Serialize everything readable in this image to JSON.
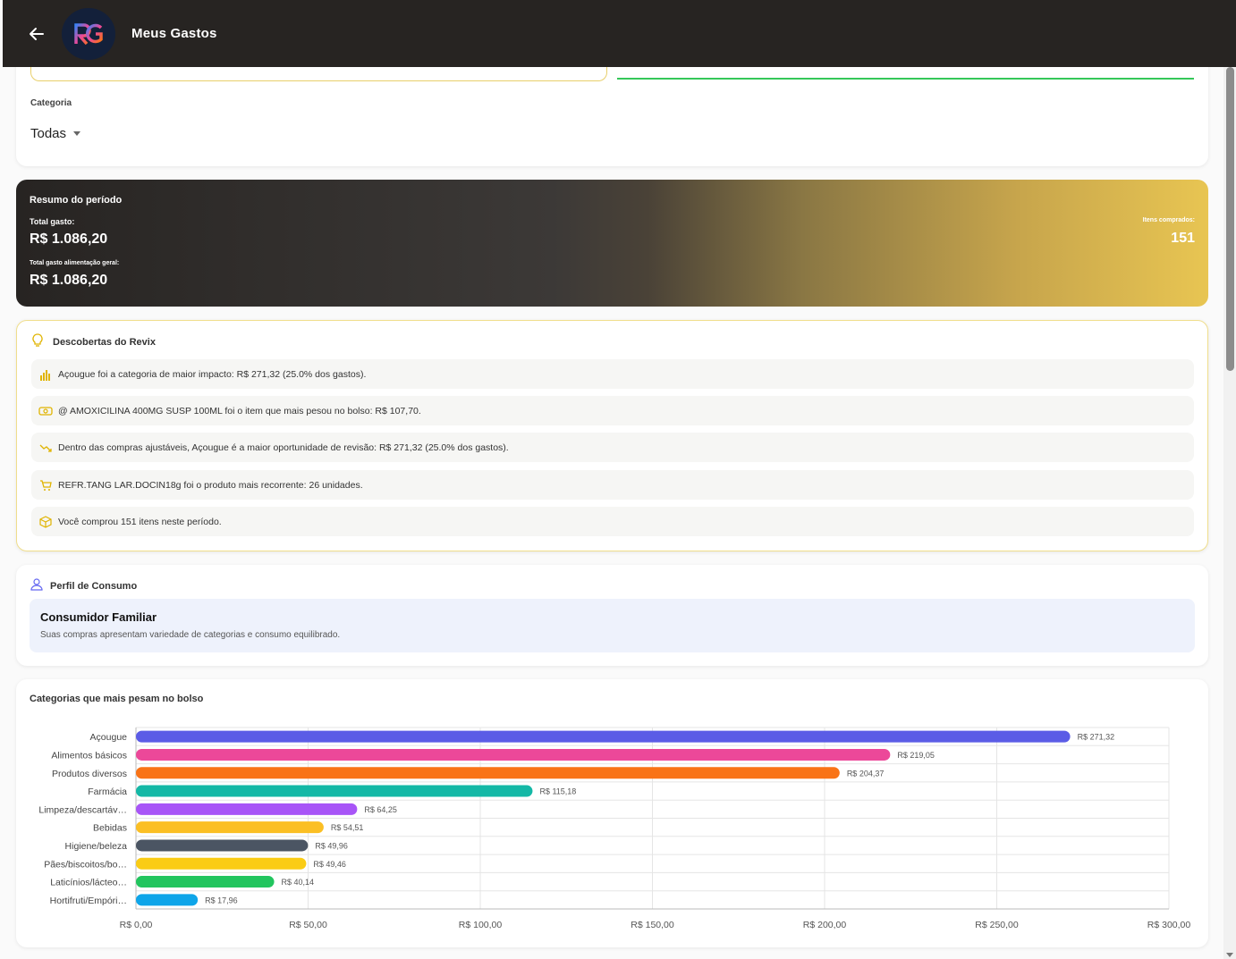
{
  "header": {
    "title": "Meus Gastos",
    "logo_text": "RG"
  },
  "filters": {
    "category_label": "Categoria",
    "category_value": "Todas"
  },
  "summary": {
    "title": "Resumo do período",
    "total_label": "Total gasto:",
    "total_value": "R$ 1.086,20",
    "food_label": "Total gasto alimentação geral:",
    "food_value": "R$ 1.086,20",
    "items_label": "Itens comprados:",
    "items_value": "151"
  },
  "insights": {
    "title": "Descobertas do Revix",
    "items": [
      {
        "icon": "bar-chart-icon",
        "text": "Açougue foi a categoria de maior impacto: R$ 271,32 (25.0% dos gastos)."
      },
      {
        "icon": "money-icon",
        "text": "@ AMOXICILINA 400MG SUSP 100ML foi o item que mais pesou no bolso: R$ 107,70."
      },
      {
        "icon": "trending-down-icon",
        "text": "Dentro das compras ajustáveis, Açougue é a maior oportunidade de revisão: R$ 271,32 (25.0% dos gastos)."
      },
      {
        "icon": "cart-icon",
        "text": "REFR.TANG LAR.DOCIN18g foi o produto mais recorrente: 26 unidades."
      },
      {
        "icon": "box-icon",
        "text": "Você comprou 151 itens neste período."
      }
    ]
  },
  "profile": {
    "title": "Perfil de Consumo",
    "name": "Consumidor Familiar",
    "description": "Suas compras apresentam variedade de categorias e consumo equilibrado."
  },
  "chart_data": {
    "type": "bar",
    "orientation": "horizontal",
    "title": "Categorias que mais pesam no bolso",
    "categories": [
      "Açougue",
      "Alimentos básicos",
      "Produtos diversos",
      "Farmácia",
      "Limpeza/descartáv…",
      "Bebidas",
      "Higiene/beleza",
      "Pães/biscoitos/bo…",
      "Laticínios/lácteo…",
      "Hortifruti/Empóri…"
    ],
    "values": [
      271.32,
      219.05,
      204.37,
      115.18,
      64.25,
      54.51,
      49.96,
      49.46,
      40.14,
      17.96
    ],
    "value_labels": [
      "R$ 271,32",
      "R$ 219,05",
      "R$ 204,37",
      "R$ 115,18",
      "R$ 64,25",
      "R$ 54,51",
      "R$ 49,96",
      "R$ 49,46",
      "R$ 40,14",
      "R$ 17,96"
    ],
    "colors": [
      "#5b5ce6",
      "#ec4899",
      "#f97316",
      "#14b8a6",
      "#a855f7",
      "#fbbf24",
      "#4b5563",
      "#facc15",
      "#22c55e",
      "#0ea5e9"
    ],
    "xlim": [
      0,
      300
    ],
    "xticks": [
      0,
      50,
      100,
      150,
      200,
      250,
      300
    ],
    "xtick_labels": [
      "R$ 0,00",
      "R$ 50,00",
      "R$ 100,00",
      "R$ 150,00",
      "R$ 200,00",
      "R$ 250,00",
      "R$ 300,00"
    ],
    "grid": true
  }
}
